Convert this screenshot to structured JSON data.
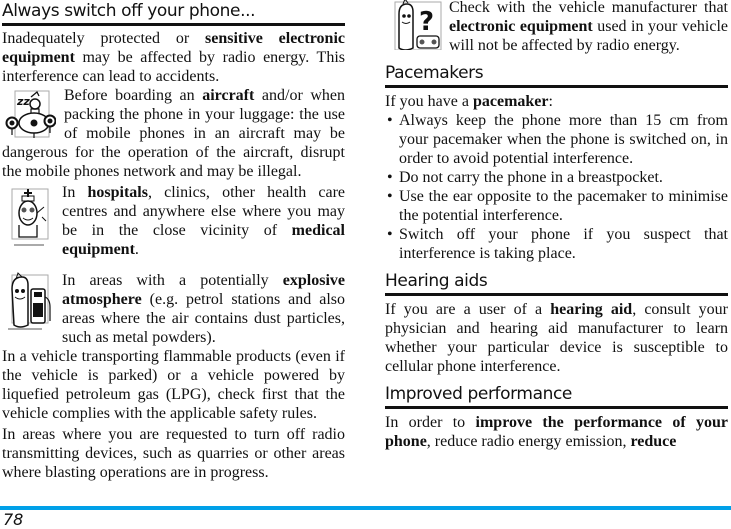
{
  "left_column": {
    "heading": "Always switch off your phone...",
    "intro": {
      "b1": "Inadequately protected or ",
      "bold1": "sensitive electronic equipment",
      "t1": " may be affected by radio energy. This interference can lead to accidents."
    },
    "aircraft": {
      "icon": "aircraft-warning-icon",
      "t1": "Before boarding an ",
      "bold1": "aircraft",
      "t2": " and/or when packing the phone in your luggage: the use of mobile phones in an aircraft may be dangerous for the operation of the aircraft, disrupt the mobile phones network and may be illegal."
    },
    "hospitals": {
      "icon": "hospital-nurse-icon",
      "t1": "In ",
      "bold1": "hospitals",
      "t2": ", clinics, other health care centres and anywhere else where you may be in the close vicinity of ",
      "bold2": "medical equipment",
      "t3": "."
    },
    "explosive": {
      "icon": "petrol-station-icon",
      "t1": "In areas with a potentially ",
      "bold1": "explosive atmosphere",
      "t2": " (e.g. petrol stations and also areas where the air contains dust particles, such as metal powders)."
    },
    "vehicle_flammable": "In a vehicle transporting flammable products (even if the vehicle is parked) or a vehicle powered by liquefied petroleum gas (LPG), check first that the vehicle complies with the applicable safety rules.",
    "blasting": "In areas where you are requested to turn off radio transmitting devices, such as quarries or other areas where blasting operations are in progress."
  },
  "right_column": {
    "vehicle_check": {
      "icon": "vehicle-question-icon",
      "t1": "Check with the vehicle manufacturer that ",
      "bold1": "electronic equipment",
      "t2": " used in your vehicle will not be affected by radio energy."
    },
    "pacemakers": {
      "heading": "Pacemakers",
      "intro_t1": "If you have a ",
      "intro_bold": "pacemaker",
      "intro_t2": ":",
      "bullet_glyph": "•",
      "bullets": [
        "Always keep the phone more than 15 cm from your pacemaker when the phone is switched on, in order to avoid potential interference.",
        "Do not carry the phone in a breastpocket.",
        "Use the ear opposite to the pacemaker to minimise the potential interference.",
        "Switch off your phone if you suspect that interference is taking place."
      ]
    },
    "hearing_aids": {
      "heading": "Hearing aids",
      "t1": "If you are a user of a ",
      "bold1": "hearing aid",
      "t2": ", consult your physician and hearing aid manufacturer to learn whether your particular device is susceptible to cellular phone interference."
    },
    "improved_performance": {
      "heading": "Improved performance",
      "t1": "In order to ",
      "bold1": "improve the performance of your phone",
      "t2": ", reduce radio energy emission, ",
      "bold2": "reduce"
    }
  },
  "footer": {
    "page_number": "78",
    "accent_color": "#00a0e8"
  }
}
